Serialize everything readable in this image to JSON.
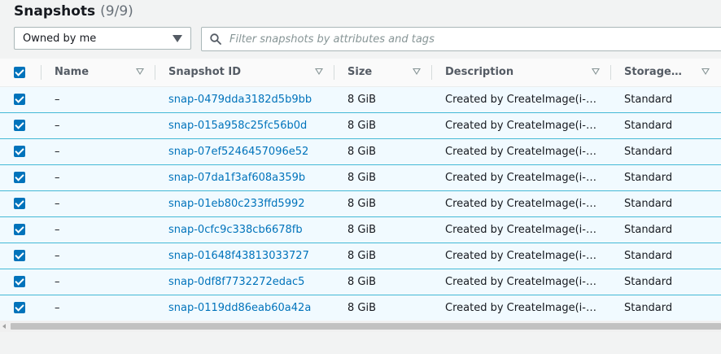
{
  "header": {
    "title": "Snapshots",
    "count": "(9/9)"
  },
  "owner_filter": {
    "value": "Owned by me"
  },
  "search": {
    "placeholder": "Filter snapshots by attributes and tags",
    "value": ""
  },
  "table": {
    "columns": [
      "Name",
      "Snapshot ID",
      "Size",
      "Description",
      "Storage…"
    ],
    "rows": [
      {
        "name": "–",
        "id": "snap-0479dda3182d5b9bb",
        "size": "8 GiB",
        "description": "Created by CreateImage(i-…",
        "storage": "Standard"
      },
      {
        "name": "–",
        "id": "snap-015a958c25fc56b0d",
        "size": "8 GiB",
        "description": "Created by CreateImage(i-…",
        "storage": "Standard"
      },
      {
        "name": "–",
        "id": "snap-07ef5246457096e52",
        "size": "8 GiB",
        "description": "Created by CreateImage(i-…",
        "storage": "Standard"
      },
      {
        "name": "–",
        "id": "snap-07da1f3af608a359b",
        "size": "8 GiB",
        "description": "Created by CreateImage(i-…",
        "storage": "Standard"
      },
      {
        "name": "–",
        "id": "snap-01eb80c233ffd5992",
        "size": "8 GiB",
        "description": "Created by CreateImage(i-…",
        "storage": "Standard"
      },
      {
        "name": "–",
        "id": "snap-0cfc9c338cb6678fb",
        "size": "8 GiB",
        "description": "Created by CreateImage(i-…",
        "storage": "Standard"
      },
      {
        "name": "–",
        "id": "snap-01648f43813033727",
        "size": "8 GiB",
        "description": "Created by CreateImage(i-…",
        "storage": "Standard"
      },
      {
        "name": "–",
        "id": "snap-0df8f7732272edac5",
        "size": "8 GiB",
        "description": "Created by CreateImage(i-…",
        "storage": "Standard"
      },
      {
        "name": "–",
        "id": "snap-0119dd86eab60a42a",
        "size": "8 GiB",
        "description": "Created by CreateImage(i-…",
        "storage": "Standard"
      }
    ]
  },
  "colors": {
    "accent": "#0073bb",
    "selected_row_bg": "#f1faff",
    "selected_row_border": "#44b9d6"
  }
}
